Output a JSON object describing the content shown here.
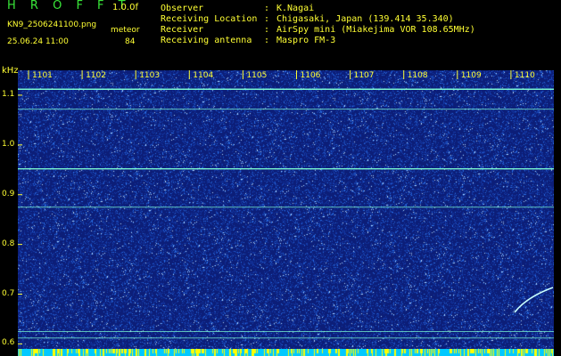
{
  "header": {
    "app_title": "H R O F F T",
    "version": "1.0.0f",
    "filename": "KN9_2506241100.png",
    "mode": "meteor",
    "datetime": "25.06.24 11:00",
    "count": "84",
    "fields": [
      {
        "label": "Observer",
        "value": "K.Nagai"
      },
      {
        "label": "Receiving Location",
        "value": "Chigasaki, Japan (139.414 35.340)"
      },
      {
        "label": "Receiver",
        "value": "AirSpy mini (Miakejima VOR 108.65MHz)"
      },
      {
        "label": "Receiving antenna",
        "value": "Maspro FM-3"
      }
    ]
  },
  "plot": {
    "y_unit": "kHz",
    "x_ticks": [
      "1101",
      "1102",
      "1103",
      "1104",
      "1105",
      "1106",
      "1107",
      "1108",
      "1109",
      "1110"
    ],
    "y_ticks": [
      "1.1",
      "1.0",
      "0.9",
      "0.8",
      "0.7",
      "0.6"
    ],
    "y_range": [
      0.59,
      1.15
    ],
    "bands_khz": [
      1.112,
      1.072,
      0.952,
      0.875,
      0.625,
      0.612
    ],
    "colors": {
      "background": "#0c1e78",
      "band": "#7fffd4",
      "text": "#ffff33",
      "title": "#39e639",
      "bottom_bar": "#00c8ff",
      "bottom_ticks": "#ffff00"
    }
  }
}
